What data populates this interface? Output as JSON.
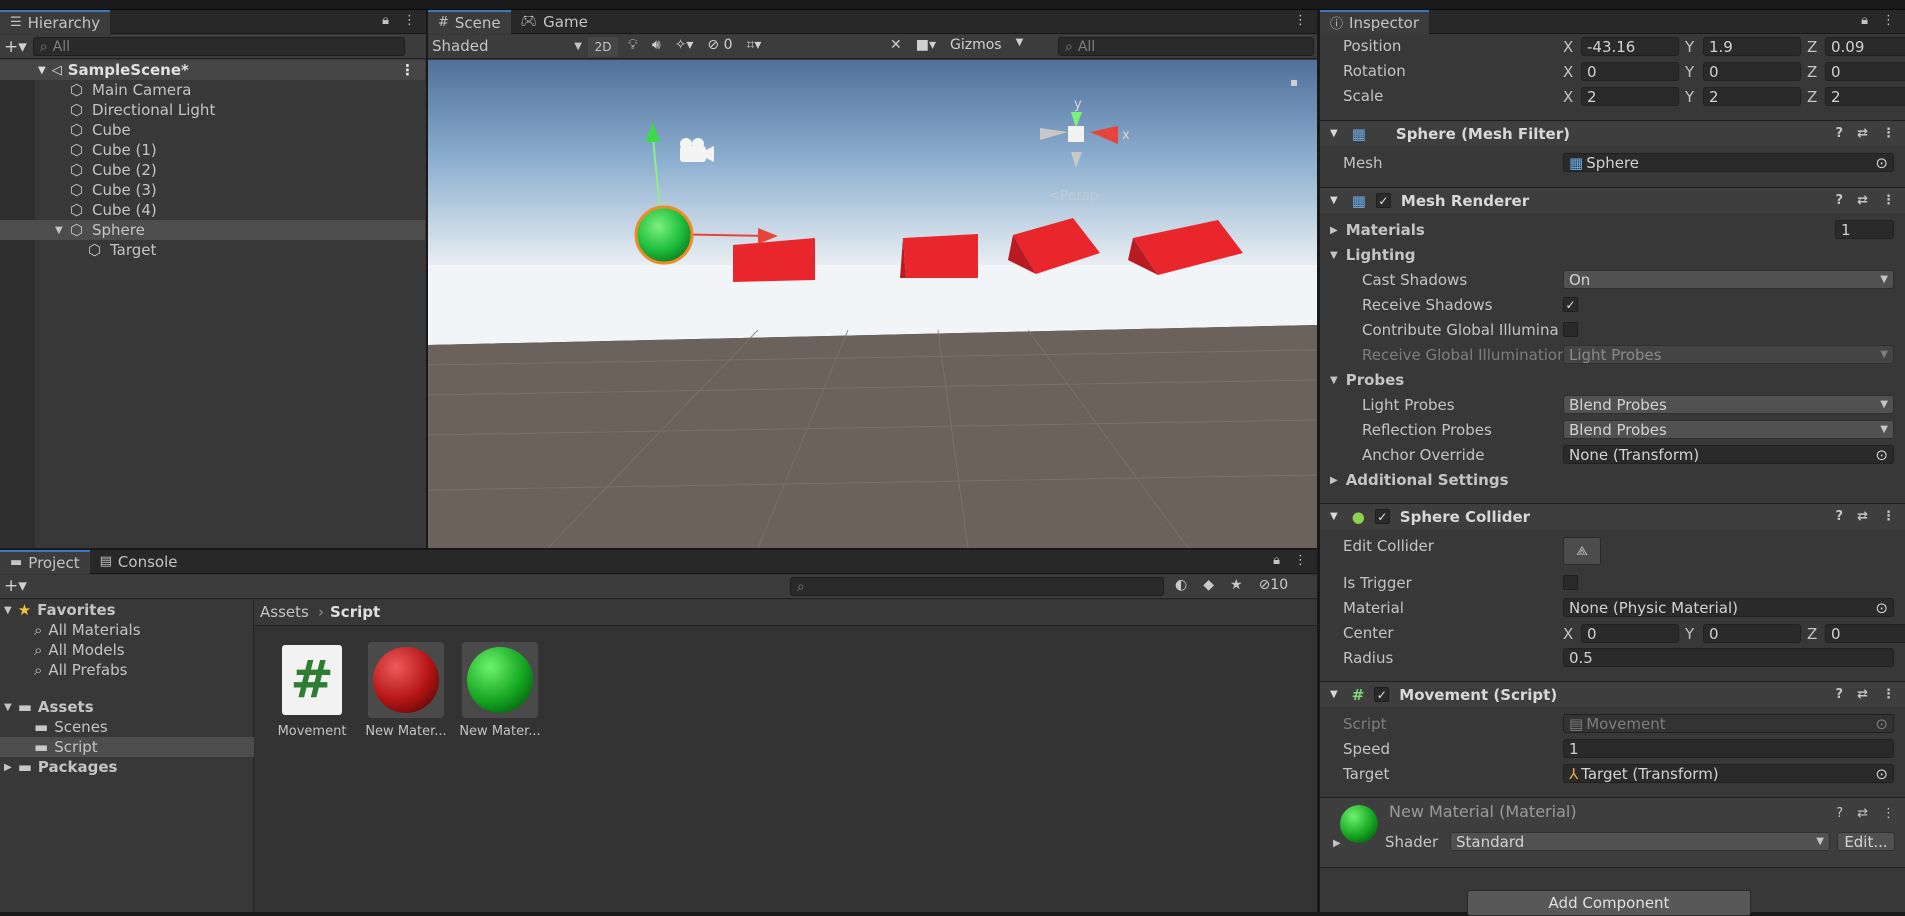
{
  "hierarchy": {
    "tab": "Hierarchy",
    "search_placeholder": "All",
    "scene": "SampleScene*",
    "items": [
      "Main Camera",
      "Directional Light",
      "Cube",
      "Cube (1)",
      "Cube (2)",
      "Cube (3)",
      "Cube (4)",
      "Sphere",
      "Target"
    ]
  },
  "scene_view": {
    "tabs": [
      "Scene",
      "Game"
    ],
    "shading": "Shaded",
    "mode_2d": "2D",
    "hidden_count": "0",
    "gizmos": "Gizmos",
    "search_placeholder": "All",
    "persp": "<Persp",
    "axis_y": "y",
    "axis_x": "x"
  },
  "project": {
    "tabs": [
      "Project",
      "Console"
    ],
    "hidden_count": "10",
    "favorites": "Favorites",
    "fav_items": [
      "All Materials",
      "All Models",
      "All Prefabs"
    ],
    "assets": "Assets",
    "asset_folders": [
      "Scenes",
      "Script"
    ],
    "packages": "Packages",
    "breadcrumb": [
      "Assets",
      "Script"
    ],
    "files": [
      "Movement",
      "New Mater...",
      "New Mater..."
    ],
    "script_glyph": "#"
  },
  "inspector": {
    "tab": "Inspector",
    "transform": {
      "position_label": "Position",
      "position": [
        "-43.16",
        "1.9",
        "0.09"
      ],
      "rotation_label": "Rotation",
      "rotation": [
        "0",
        "0",
        "0"
      ],
      "scale_label": "Scale",
      "scale": [
        "2",
        "2",
        "2"
      ],
      "axes": [
        "X",
        "Y",
        "Z"
      ]
    },
    "mesh_filter": {
      "title": "Sphere (Mesh Filter)",
      "mesh_label": "Mesh",
      "mesh": "Sphere"
    },
    "mesh_renderer": {
      "title": "Mesh Renderer",
      "materials_label": "Materials",
      "materials_count": "1",
      "lighting": "Lighting",
      "cast_shadows_label": "Cast Shadows",
      "cast_shadows": "On",
      "receive_shadows_label": "Receive Shadows",
      "contribute_gi_label": "Contribute Global Illumination",
      "receive_gi_label": "Receive Global Illumination",
      "receive_gi": "Light Probes",
      "probes": "Probes",
      "light_probes_label": "Light Probes",
      "light_probes": "Blend Probes",
      "reflection_probes_label": "Reflection Probes",
      "reflection_probes": "Blend Probes",
      "anchor_label": "Anchor Override",
      "anchor": "None (Transform)",
      "additional": "Additional Settings"
    },
    "sphere_collider": {
      "title": "Sphere Collider",
      "edit_label": "Edit Collider",
      "trigger_label": "Is Trigger",
      "material_label": "Material",
      "material": "None (Physic Material)",
      "center_label": "Center",
      "center": [
        "0",
        "0",
        "0"
      ],
      "radius_label": "Radius",
      "radius": "0.5"
    },
    "movement": {
      "title": "Movement (Script)",
      "script_label": "Script",
      "script": "Movement",
      "speed_label": "Speed",
      "speed": "1",
      "target_label": "Target",
      "target": "Target (Transform)"
    },
    "material": {
      "title": "New Material (Material)",
      "shader_label": "Shader",
      "shader": "Standard",
      "edit": "Edit..."
    },
    "add_component": "Add Component"
  },
  "colors": {
    "accent": "#3a79bb",
    "cube_red": "#e8262c",
    "sphere_green": "#1fbf3c"
  }
}
